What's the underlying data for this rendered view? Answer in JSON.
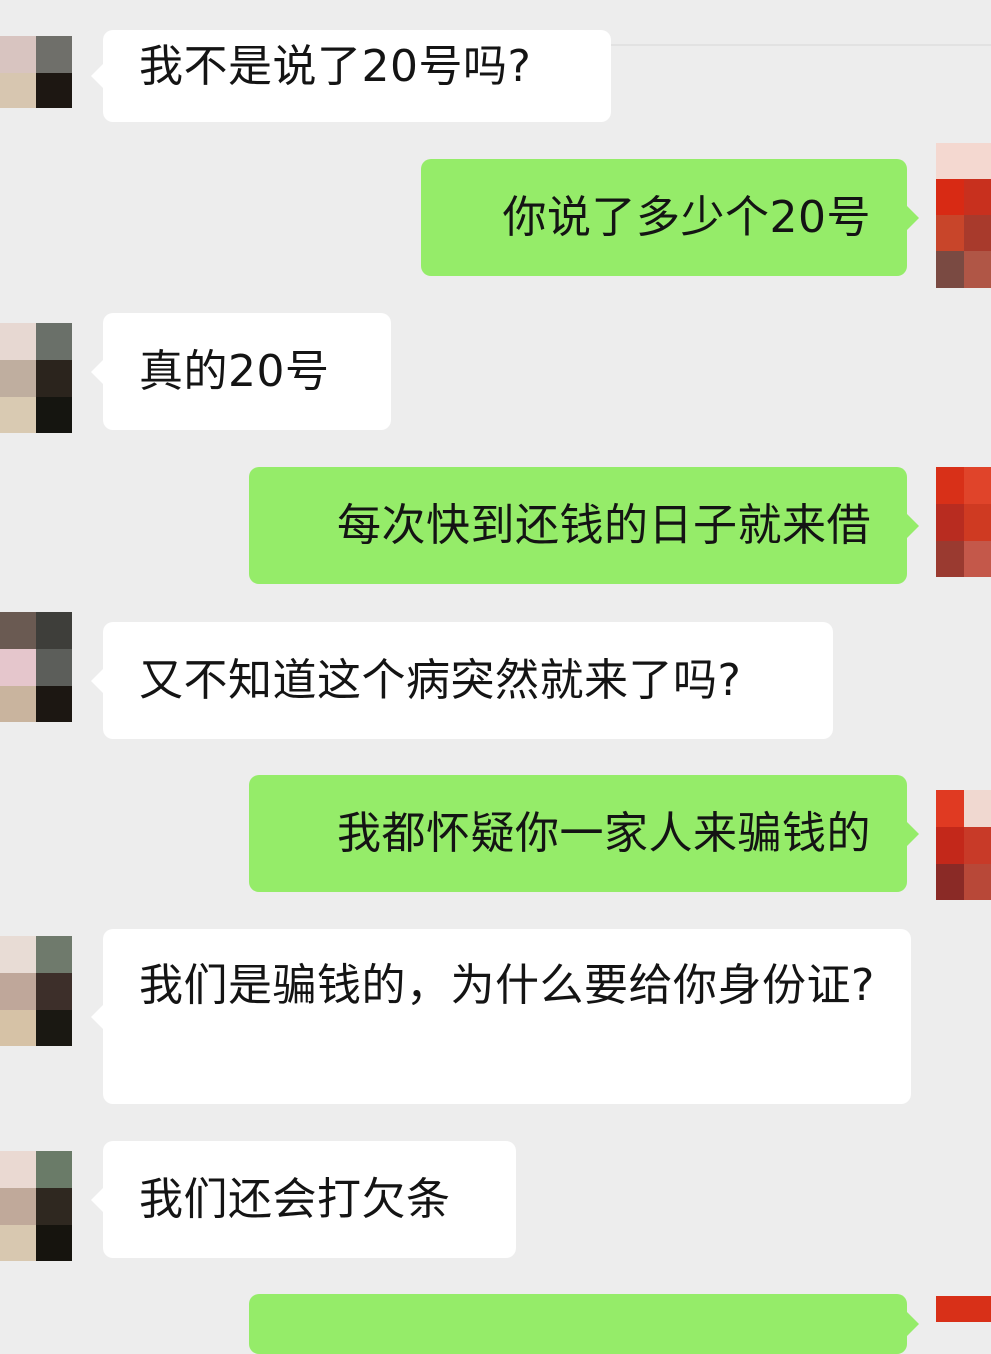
{
  "messages": [
    {
      "side": "in",
      "text": "我不是说了20号吗?"
    },
    {
      "side": "out",
      "text": "你说了多少个20号"
    },
    {
      "side": "in",
      "text": "真的20号"
    },
    {
      "side": "out",
      "text": "每次快到还钱的日子就来借"
    },
    {
      "side": "in",
      "text": "又不知道这个病突然就来了吗?"
    },
    {
      "side": "out",
      "text": "我都怀疑你一家人来骗钱的"
    },
    {
      "side": "in",
      "text": "我们是骗钱的，为什么要给你身份证?"
    },
    {
      "side": "in",
      "text": "我们还会打欠条"
    },
    {
      "side": "out",
      "text": ""
    }
  ],
  "colors": {
    "background": "#ededed",
    "incoming_bubble": "#ffffff",
    "outgoing_bubble": "#95ec69",
    "text": "#141414"
  },
  "icons": {
    "contact_avatar": "pixelated-avatar-icon",
    "self_avatar": "pixelated-avatar-icon"
  }
}
